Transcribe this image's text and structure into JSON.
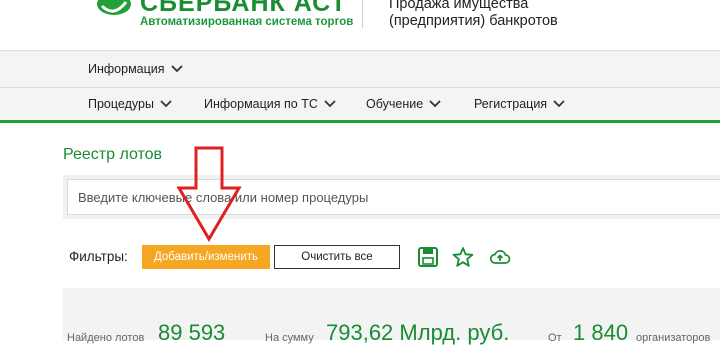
{
  "header": {
    "logo_title": "СБЕРБАНК АСТ",
    "logo_subtitle": "Автоматизированная система торгов",
    "description_line1": "Продажа имущества",
    "description_line2": "(предприятия) банкротов"
  },
  "nav": {
    "info_label": "Информация",
    "items": [
      {
        "label": "Процедуры"
      },
      {
        "label": "Информация по ТС"
      },
      {
        "label": "Обучение"
      },
      {
        "label": "Регистрация"
      }
    ]
  },
  "main": {
    "page_title": "Реестр лотов",
    "search": {
      "placeholder": "Введите ключевые слова или номер процедуры",
      "value": ""
    },
    "filters": {
      "label": "Фильтры:",
      "add_button": "Добавить/изменить",
      "clear_button": "Очистить все",
      "icons": [
        "save-icon",
        "star-icon",
        "cloud-upload-icon"
      ]
    },
    "stats": {
      "found_label": "Найдено лотов",
      "found_value": "89 593",
      "sum_label": "На сумму",
      "sum_value": "793,62 Млрд. руб.",
      "org_prefix": "От",
      "org_value": "1 840",
      "org_suffix": "организаторов"
    }
  },
  "colors": {
    "brand_green": "#21a038",
    "title_green": "#1a8c34",
    "orange": "#f5a623",
    "annotation_red": "#e02020"
  }
}
